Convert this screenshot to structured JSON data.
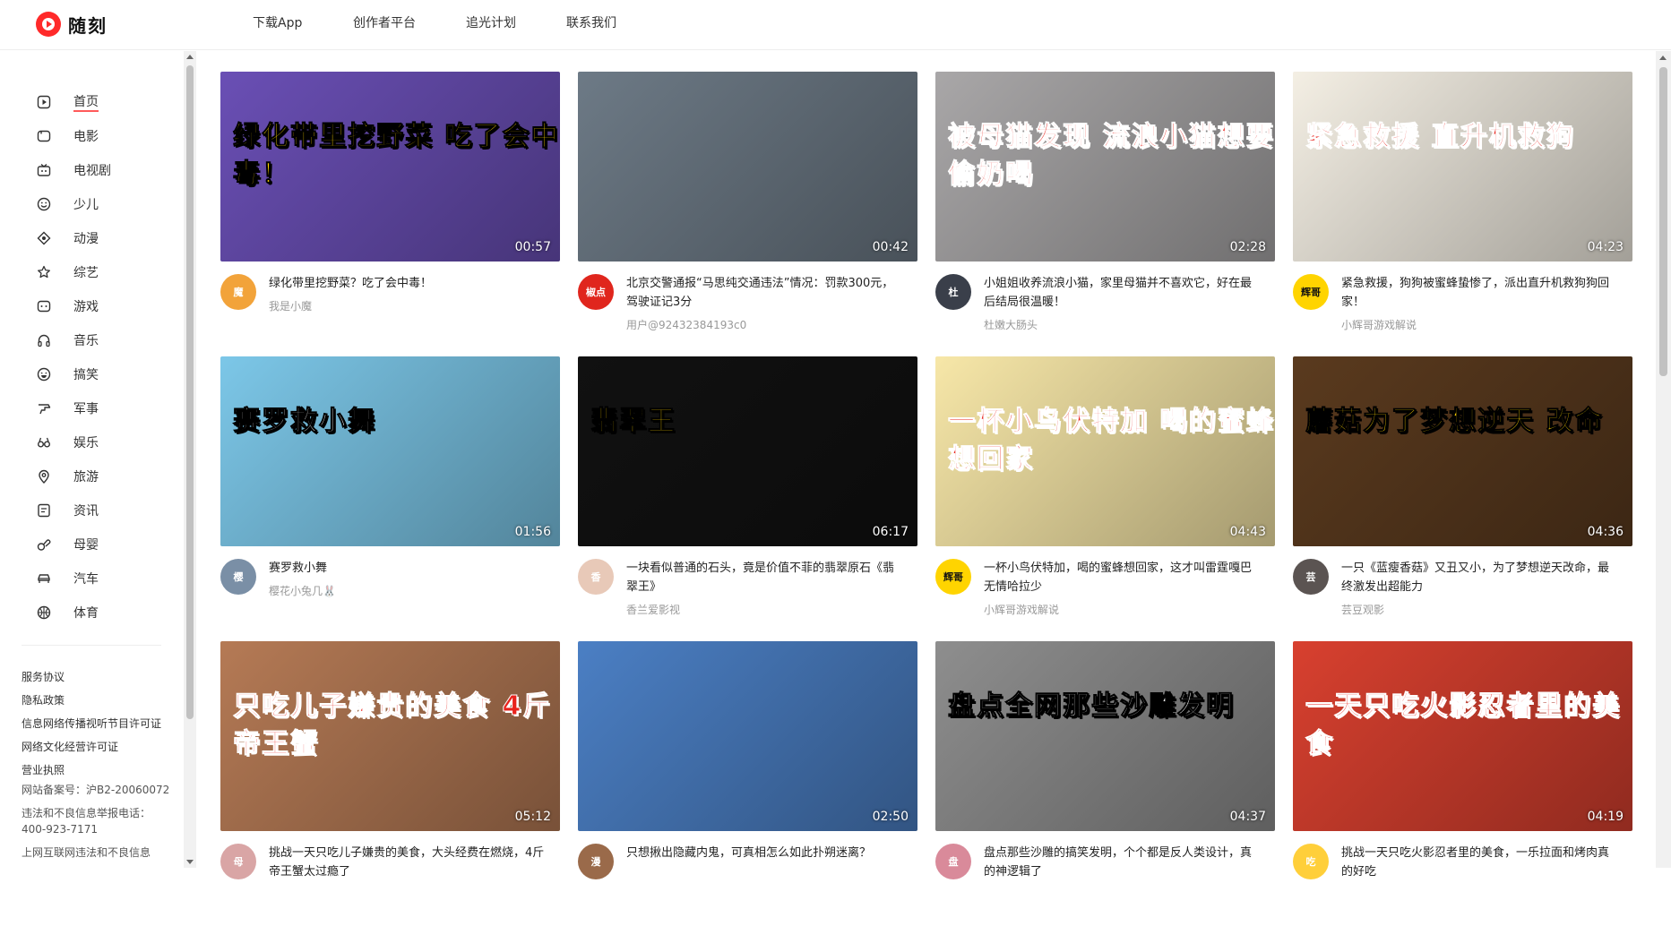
{
  "header": {
    "logo_text": "随刻",
    "nav": [
      "下载App",
      "创作者平台",
      "追光计划",
      "联系我们"
    ]
  },
  "sidebar": {
    "items": [
      {
        "label": "首页",
        "icon": "play-square-icon",
        "active": true
      },
      {
        "label": "电影",
        "icon": "film-icon"
      },
      {
        "label": "电视剧",
        "icon": "tv-icon"
      },
      {
        "label": "少儿",
        "icon": "smile-icon"
      },
      {
        "label": "动漫",
        "icon": "anime-icon"
      },
      {
        "label": "综艺",
        "icon": "star-icon"
      },
      {
        "label": "游戏",
        "icon": "gamepad-icon"
      },
      {
        "label": "音乐",
        "icon": "headphones-icon"
      },
      {
        "label": "搞笑",
        "icon": "laugh-icon"
      },
      {
        "label": "军事",
        "icon": "military-icon"
      },
      {
        "label": "娱乐",
        "icon": "glasses-icon"
      },
      {
        "label": "旅游",
        "icon": "location-icon"
      },
      {
        "label": "资讯",
        "icon": "news-icon"
      },
      {
        "label": "母婴",
        "icon": "baby-icon"
      },
      {
        "label": "汽车",
        "icon": "car-icon"
      },
      {
        "label": "体育",
        "icon": "ball-icon"
      }
    ],
    "footer": {
      "agreement": "服务协议",
      "privacy": "隐私政策",
      "license1": "信息网络传播视听节目许可证",
      "license2": "网络文化经营许可证",
      "business": "营业执照",
      "icp": "网站备案号：沪B2-20060072",
      "report": "违法和不良信息举报电话：400-923-7171",
      "more": "上网互联网违法和不良信息"
    }
  },
  "videos": [
    {
      "caption": "绿化带里挖野菜 吃了会中毒！",
      "duration": "00:57",
      "title": "绿化带里挖野菜？吃了会中毒！",
      "author": "我是小魔",
      "bg": "#6a4fb5",
      "avatar_bg": "#f2a33a",
      "avatar_text": "魔"
    },
    {
      "caption": "",
      "duration": "00:42",
      "title": "北京交警通报“马思纯交通违法”情况：罚款300元，驾驶证记3分",
      "author": "用户@92432384193c0",
      "bg": "#6d7a86",
      "avatar_bg": "#e0261d",
      "avatar_text": "椒点"
    },
    {
      "caption": "被母猫发现 流浪小猫想要偷奶喝",
      "duration": "02:28",
      "title": "小姐姐收养流浪小猫，家里母猫并不喜欢它，好在最后结局很温暖！",
      "author": "杜嫩大肠头",
      "bg": "#a9a7a8",
      "avatar_bg": "#3a3f4a",
      "avatar_text": "杜"
    },
    {
      "caption": "紧急救援 直升机救狗",
      "duration": "04:23",
      "title": "紧急救援，狗狗被蜜蜂蛰惨了，派出直升机救狗狗回家！",
      "author": "小辉哥游戏解说",
      "bg": "#f4efe4",
      "avatar_bg": "#ffd400",
      "avatar_text": "辉哥"
    },
    {
      "caption": "赛罗救小舞",
      "duration": "01:56",
      "title": "赛罗救小舞",
      "author": "樱花小兔几🐰",
      "bg": "#7cc7e8",
      "avatar_bg": "#7a8fa6",
      "avatar_text": "樱"
    },
    {
      "caption": "翡翠王",
      "duration": "06:17",
      "title": "一块看似普通的石头，竟是价值不菲的翡翠原石《翡翠王》",
      "author": "香兰爱影视",
      "bg": "#111111",
      "avatar_bg": "#e8c9b8",
      "avatar_text": "香"
    },
    {
      "caption": "一杯小鸟伏特加 喝的蜜蜂想回家",
      "duration": "04:43",
      "title": "一杯小鸟伏特加，喝的蜜蜂想回家，这才叫雷霆嘎巴无情哈拉少",
      "author": "小辉哥游戏解说",
      "bg": "#f7e7a8",
      "avatar_bg": "#ffd400",
      "avatar_text": "辉哥"
    },
    {
      "caption": "蘑菇为了梦想逆天 改命",
      "duration": "04:36",
      "title": "一只《蓝瘦香菇》又丑又小，为了梦想逆天改命，最终激发出超能力",
      "author": "芸豆观影",
      "bg": "#5a3a1e",
      "avatar_bg": "#5b5452",
      "avatar_text": "芸"
    },
    {
      "caption": "只吃儿子嫌贵的美食 4斤帝王蟹",
      "duration": "05:12",
      "title": "挑战一天只吃儿子嫌贵的美食，大头经费在燃烧，4斤帝王蟹太过瘾了",
      "author": "",
      "bg": "#b57a55",
      "avatar_bg": "#d9a5a5",
      "avatar_text": "母"
    },
    {
      "caption": "",
      "duration": "02:50",
      "title": "只想揪出隐藏内鬼，可真相怎么如此扑朔迷离？",
      "author": "",
      "bg": "#4b7fc4",
      "avatar_bg": "#9a6a4a",
      "avatar_text": "漫"
    },
    {
      "caption": "盘点全网那些沙雕发明",
      "duration": "04:37",
      "title": "盘点那些沙雕的搞笑发明，个个都是反人类设计，真的神逻辑了",
      "author": "",
      "bg": "#8e8e8e",
      "avatar_bg": "#d98a9a",
      "avatar_text": "盘"
    },
    {
      "caption": "一天只吃火影忍者里的美食",
      "duration": "04:19",
      "title": "挑战一天只吃火影忍者里的美食，一乐拉面和烤肉真的好吃",
      "author": "",
      "bg": "#d8402f",
      "avatar_bg": "#ffcf3a",
      "avatar_text": "吃"
    }
  ]
}
